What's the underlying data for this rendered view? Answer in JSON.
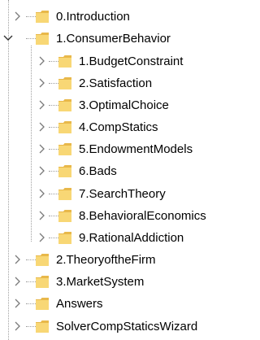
{
  "tree": {
    "items": [
      {
        "label": "0.Introduction",
        "level": 0,
        "expanded": false
      },
      {
        "label": "1.ConsumerBehavior",
        "level": 0,
        "expanded": true
      },
      {
        "label": "1.BudgetConstraint",
        "level": 1,
        "expanded": false
      },
      {
        "label": "2.Satisfaction",
        "level": 1,
        "expanded": false
      },
      {
        "label": "3.OptimalChoice",
        "level": 1,
        "expanded": false
      },
      {
        "label": "4.CompStatics",
        "level": 1,
        "expanded": false
      },
      {
        "label": "5.EndowmentModels",
        "level": 1,
        "expanded": false
      },
      {
        "label": "6.Bads",
        "level": 1,
        "expanded": false
      },
      {
        "label": "7.SearchTheory",
        "level": 1,
        "expanded": false
      },
      {
        "label": "8.BehavioralEconomics",
        "level": 1,
        "expanded": false
      },
      {
        "label": "9.RationalAddiction",
        "level": 1,
        "expanded": false
      },
      {
        "label": "2.TheoryoftheFirm",
        "level": 0,
        "expanded": false
      },
      {
        "label": "3.MarketSystem",
        "level": 0,
        "expanded": false
      },
      {
        "label": "Answers",
        "level": 0,
        "expanded": false
      },
      {
        "label": "SolverCompStaticsWizard",
        "level": 0,
        "expanded": false
      }
    ]
  },
  "icons": {
    "expander_collapsed": "chevron-right-icon",
    "expander_expanded": "chevron-down-icon",
    "folder": "folder-icon"
  },
  "colors": {
    "folder_fill": "#F8D775",
    "folder_tab": "#E8B84A",
    "chevron": "#7a7a7a",
    "guide": "#a0a0a0"
  }
}
